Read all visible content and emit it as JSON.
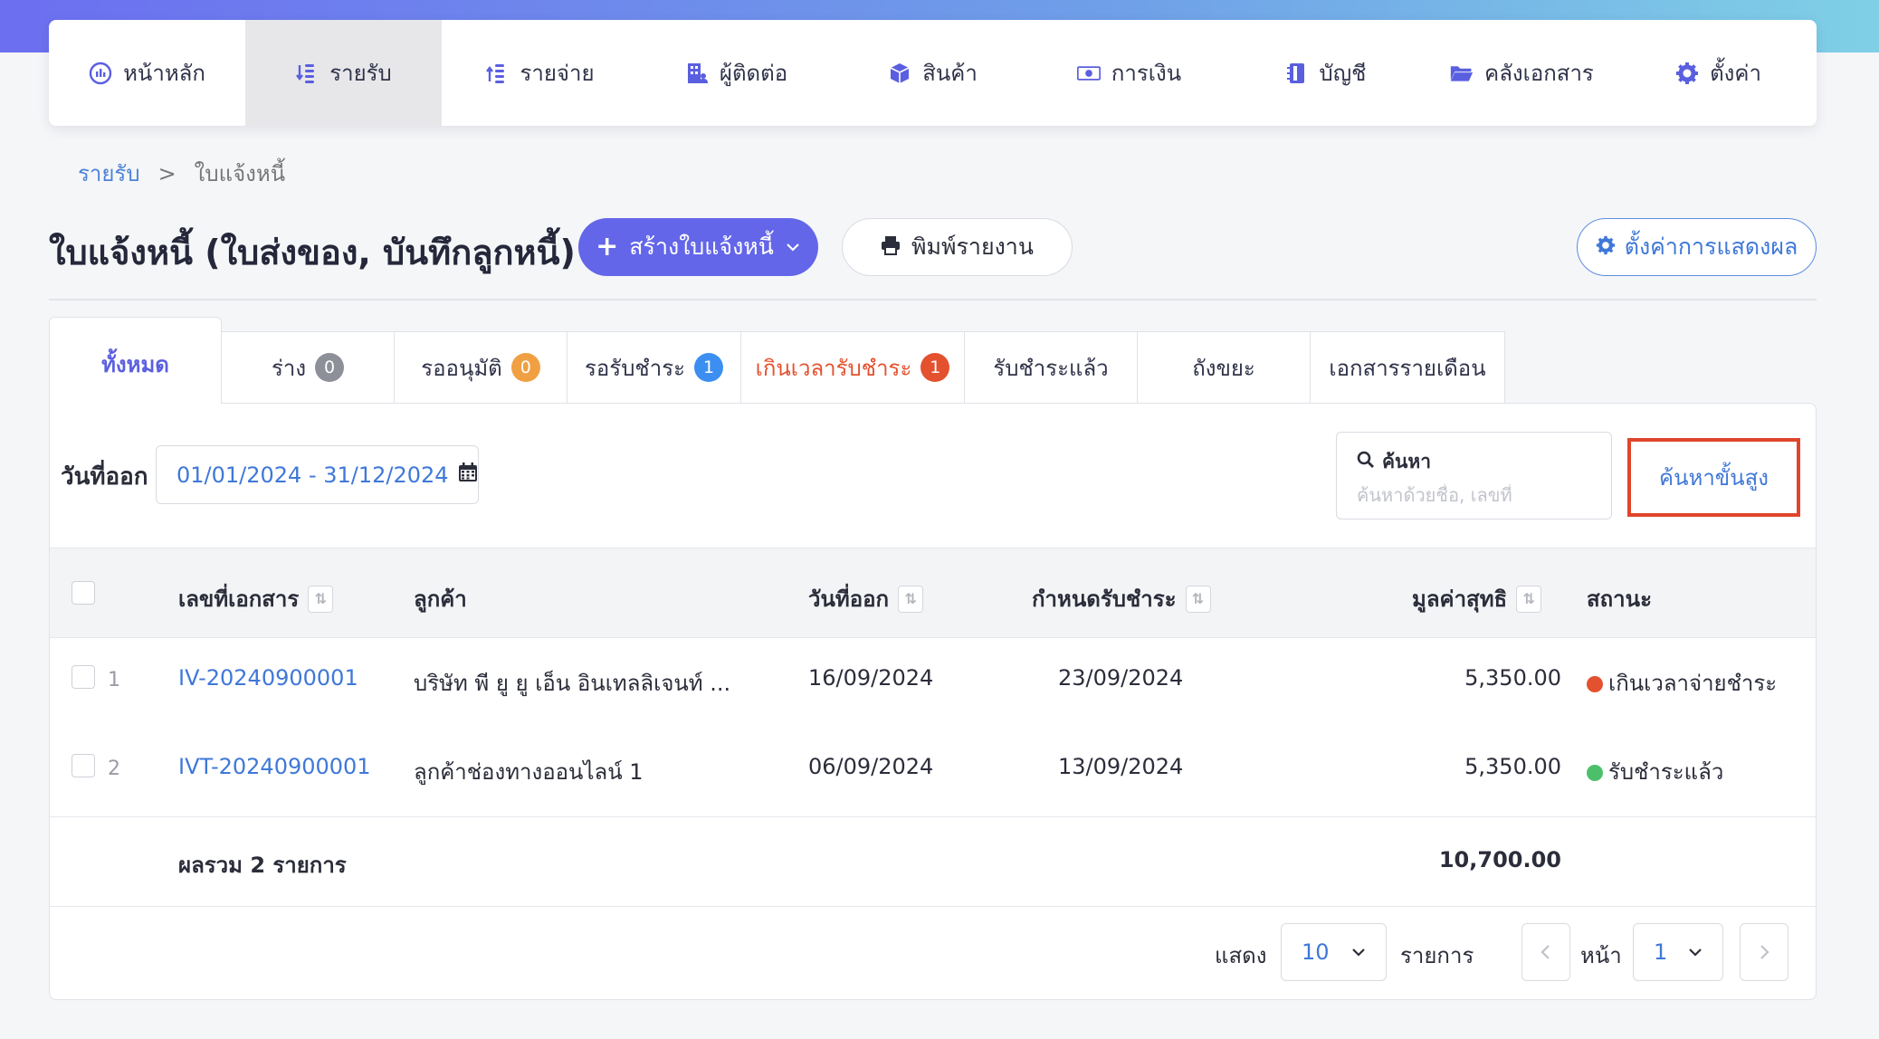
{
  "nav": {
    "items": [
      {
        "label": "หน้าหลัก",
        "icon": "dashboard-icon"
      },
      {
        "label": "รายรับ",
        "icon": "income-icon",
        "active": true
      },
      {
        "label": "รายจ่าย",
        "icon": "expense-icon"
      },
      {
        "label": "ผู้ติดต่อ",
        "icon": "building-icon"
      },
      {
        "label": "สินค้า",
        "icon": "box-icon"
      },
      {
        "label": "การเงิน",
        "icon": "money-icon"
      },
      {
        "label": "บัญชี",
        "icon": "book-icon"
      },
      {
        "label": "คลังเอกสาร",
        "icon": "folder-icon"
      },
      {
        "label": "ตั้งค่า",
        "icon": "gear-icon"
      }
    ]
  },
  "breadcrumb": {
    "parent": "รายรับ",
    "separator": ">",
    "current": "ใบแจ้งหนี้"
  },
  "page": {
    "title": "ใบแจ้งหนี้ (ใบส่งของ, บันทึกลูกหนี้)",
    "create_label": "สร้างใบแจ้งหนี้",
    "print_label": "พิมพ์รายงาน",
    "display_settings_label": "ตั้งค่าการแสดงผล"
  },
  "tabs": [
    {
      "label": "ทั้งหมด",
      "active": true
    },
    {
      "label": "ร่าง",
      "count": "0",
      "badge_color": "#8d8f99"
    },
    {
      "label": "รออนุมัติ",
      "count": "0",
      "badge_color": "#f0a042"
    },
    {
      "label": "รอรับชำระ",
      "count": "1",
      "badge_color": "#3c8ff1"
    },
    {
      "label": "เกินเวลารับชำระ",
      "count": "1",
      "badge_color": "#e4512f"
    },
    {
      "label": "รับชำระแล้ว"
    },
    {
      "label": "ถังขยะ"
    },
    {
      "label": "เอกสารรายเดือน"
    }
  ],
  "filters": {
    "date_label": "วันที่ออก",
    "date_range": "01/01/2024 - 31/12/2024",
    "search_label": "ค้นหา",
    "search_placeholder": "ค้นหาด้วยชื่อ, เลขที่",
    "advanced_search_label": "ค้นหาขั้นสูง"
  },
  "table": {
    "headers": {
      "doc_no": "เลขที่เอกสาร",
      "customer": "ลูกค้า",
      "issue_date": "วันที่ออก",
      "due_date": "กำหนดรับชำระ",
      "net_amount": "มูลค่าสุทธิ",
      "status": "สถานะ"
    },
    "rows": [
      {
        "num": "1",
        "doc_no": "IV-20240900001",
        "customer": "บริษัท พี ยู ยู เอ็น อินเทลลิเจนท์ ...",
        "issue_date": "16/09/2024",
        "due_date": "23/09/2024",
        "net_amount": "5,350.00",
        "status": "เกินเวลาจ่ายชำระ",
        "status_color": "#e4512f"
      },
      {
        "num": "2",
        "doc_no": "IVT-20240900001",
        "customer": "ลูกค้าช่องทางออนไลน์ 1",
        "issue_date": "06/09/2024",
        "due_date": "13/09/2024",
        "net_amount": "5,350.00",
        "status": "รับชำระแล้ว",
        "status_color": "#4cbf6b"
      }
    ],
    "total_label": "ผลรวม 2 รายการ",
    "total_amount": "10,700.00"
  },
  "pagination": {
    "show_label": "แสดง",
    "per_page": "10",
    "items_label": "รายการ",
    "page_label": "หน้า",
    "page": "1"
  }
}
